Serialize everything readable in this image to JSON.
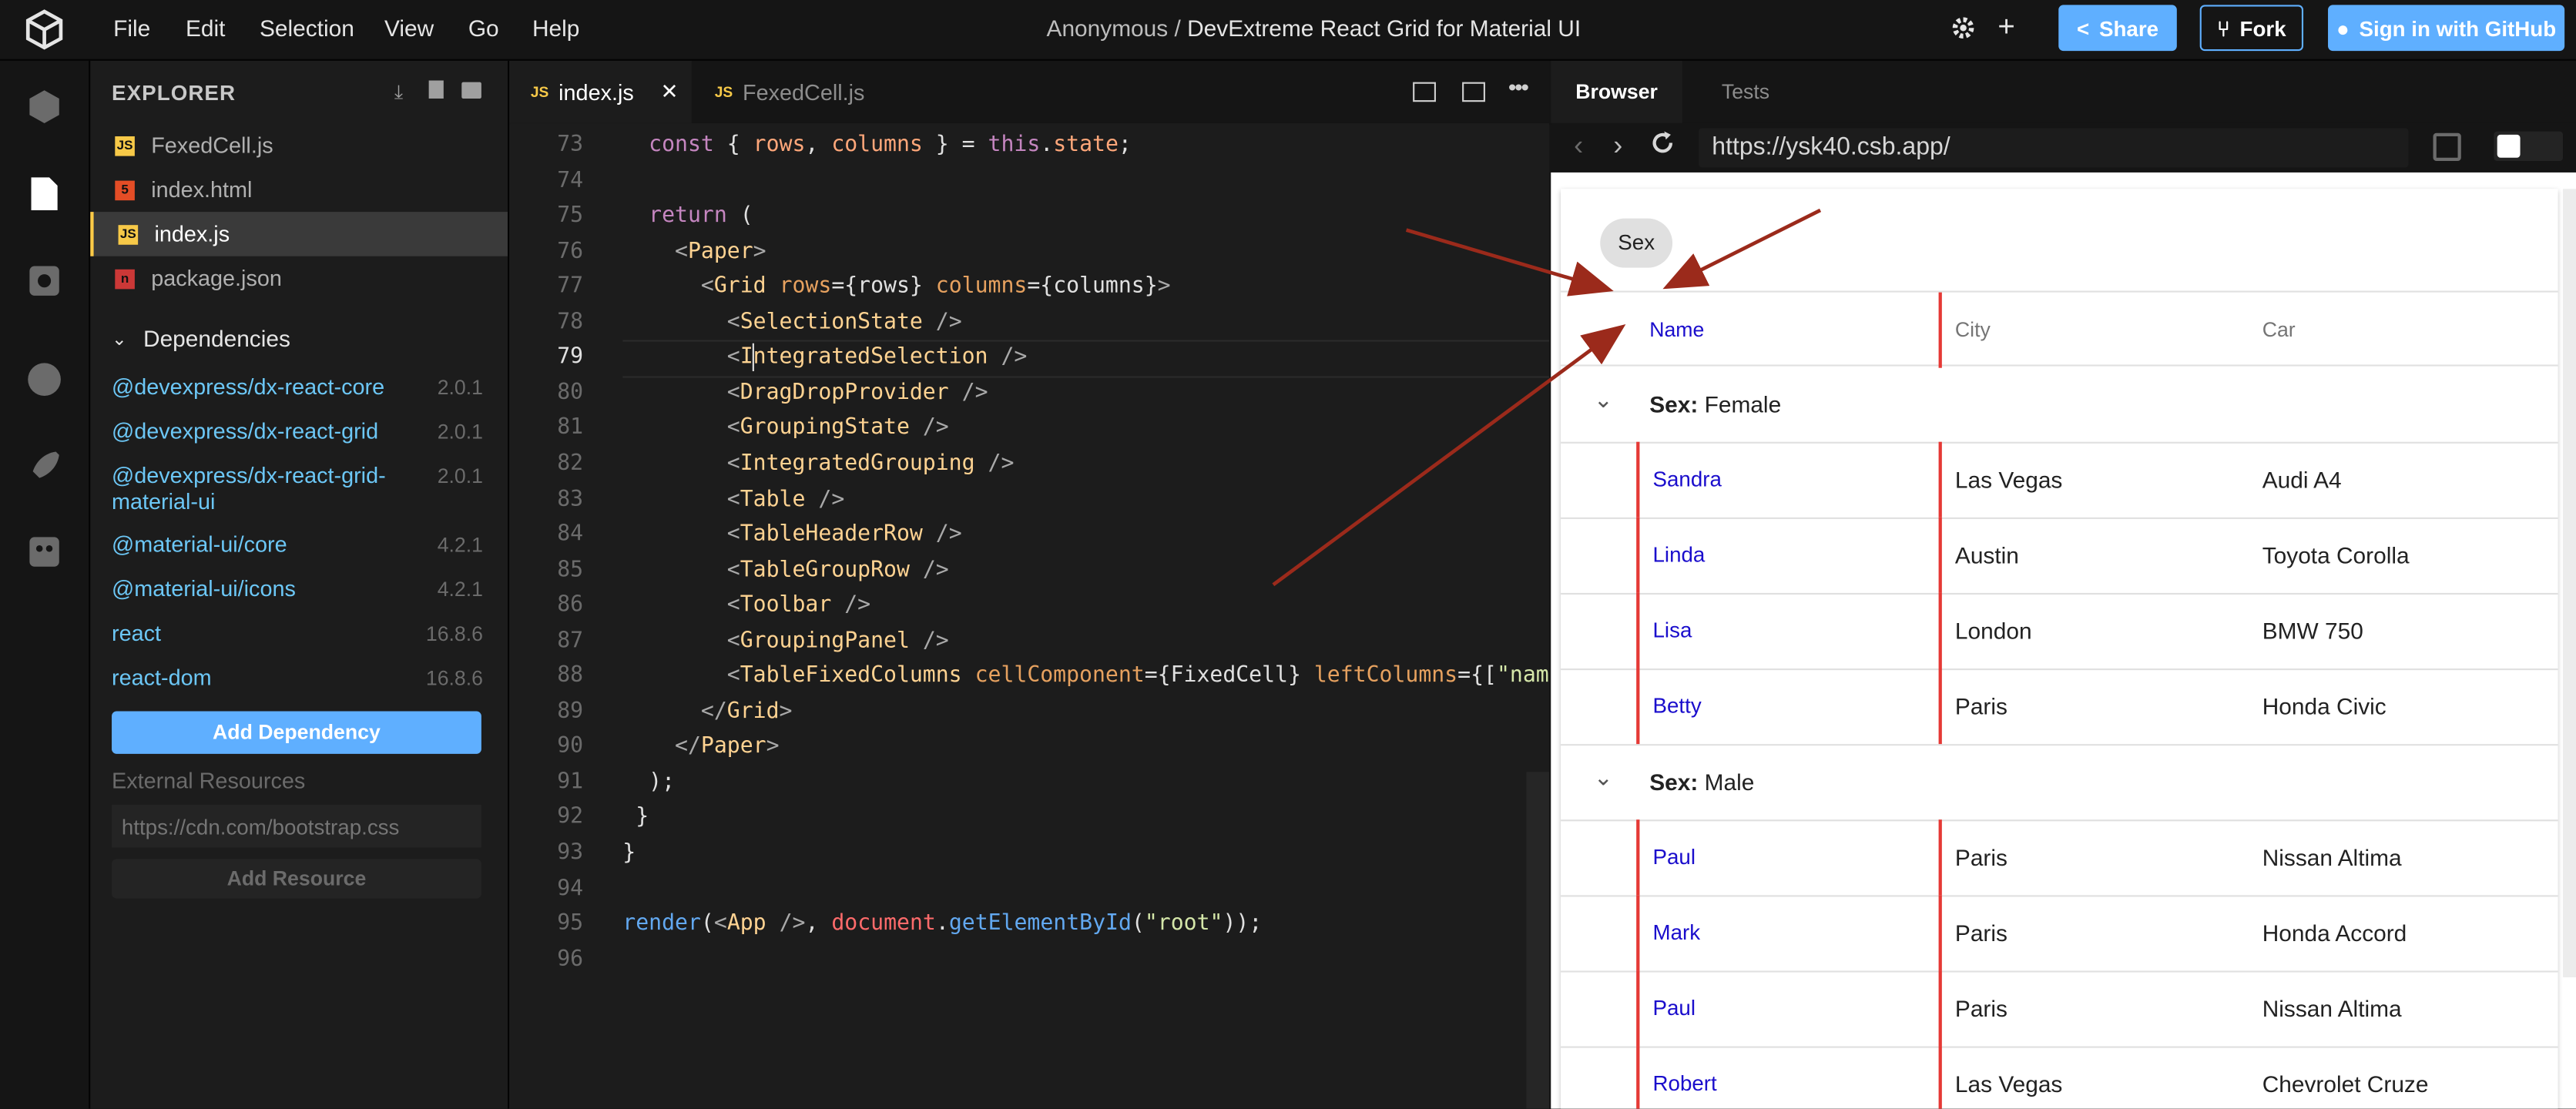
{
  "menu": [
    "File",
    "Edit",
    "Selection",
    "View",
    "Go",
    "Help"
  ],
  "title": {
    "owner": "Anonymous /",
    "project": "DevExtreme React Grid for Material UI"
  },
  "header_buttons": {
    "share": "Share",
    "fork": "Fork",
    "github": "Sign in with GitHub"
  },
  "sidebar": {
    "title": "EXPLORER",
    "files": [
      {
        "name": "FexedCell.js",
        "icon": "JS",
        "color": "#f7c948"
      },
      {
        "name": "index.html",
        "icon": "5",
        "color": "#e44d26"
      },
      {
        "name": "index.js",
        "icon": "JS",
        "color": "#f7c948"
      },
      {
        "name": "package.json",
        "icon": "n",
        "color": "#cb3837"
      }
    ],
    "dependencies_title": "Dependencies",
    "dependencies": [
      {
        "name": "@devexpress/dx-react-core",
        "version": "2.0.1"
      },
      {
        "name": "@devexpress/dx-react-grid",
        "version": "2.0.1"
      },
      {
        "name": "@devexpress/dx-react-grid-material-ui",
        "version": "2.0.1"
      },
      {
        "name": "@material-ui/core",
        "version": "4.2.1"
      },
      {
        "name": "@material-ui/icons",
        "version": "4.2.1"
      },
      {
        "name": "react",
        "version": "16.8.6"
      },
      {
        "name": "react-dom",
        "version": "16.8.6"
      }
    ],
    "add_dependency": "Add Dependency",
    "external_title": "External Resources",
    "external_placeholder": "https://cdn.com/bootstrap.css",
    "add_resource": "Add Resource"
  },
  "editor_tabs": [
    {
      "name": "index.js",
      "icon": "JS"
    },
    {
      "name": "FexedCell.js",
      "icon": "JS"
    }
  ],
  "browser": {
    "tabs": [
      "Browser",
      "Tests"
    ],
    "url": "https://ysk40.csb.app/"
  },
  "grid": {
    "group_chip": "Sex",
    "columns": [
      "Name",
      "City",
      "Car"
    ],
    "groups": [
      {
        "label": "Sex:",
        "value": "Female",
        "rows": [
          {
            "name": "Sandra",
            "city": "Las Vegas",
            "car": "Audi A4"
          },
          {
            "name": "Linda",
            "city": "Austin",
            "car": "Toyota Corolla"
          },
          {
            "name": "Lisa",
            "city": "London",
            "car": "BMW 750"
          },
          {
            "name": "Betty",
            "city": "Paris",
            "car": "Honda Civic"
          }
        ]
      },
      {
        "label": "Sex:",
        "value": "Male",
        "rows": [
          {
            "name": "Paul",
            "city": "Paris",
            "car": "Nissan Altima"
          },
          {
            "name": "Mark",
            "city": "Paris",
            "car": "Honda Accord"
          },
          {
            "name": "Paul",
            "city": "Paris",
            "car": "Nissan Altima"
          },
          {
            "name": "Robert",
            "city": "Las Vegas",
            "car": "Chevrolet Cruze"
          }
        ]
      }
    ]
  },
  "code_lines": [
    {
      "n": "73",
      "html": "  <span class='kw'>const</span> { <span class='vr'>rows</span>, <span class='vr'>columns</span> } = <span class='th'>this</span>.<span class='vr'>state</span>;"
    },
    {
      "n": "74",
      "html": ""
    },
    {
      "n": "75",
      "html": "  <span class='kw'>return</span> ("
    },
    {
      "n": "76",
      "html": "    <span class='pn'>&lt;</span><span class='tg'>Paper</span><span class='pn'>&gt;</span>"
    },
    {
      "n": "77",
      "html": "      <span class='pn'>&lt;</span><span class='tg'>Grid</span> <span class='at'>rows</span>={rows} <span class='at'>columns</span>={columns}<span class='pn'>&gt;</span>"
    },
    {
      "n": "78",
      "html": "        <span class='pn'>&lt;</span><span class='tg'>SelectionState</span> <span class='pn'>/&gt;</span>"
    },
    {
      "n": "79",
      "html": "        <span class='pn'>&lt;</span><span class='tg'>IntegratedSelection</span> <span class='pn'>/&gt;</span>"
    },
    {
      "n": "80",
      "html": "        <span class='pn'>&lt;</span><span class='tg'>DragDropProvider</span> <span class='pn'>/&gt;</span>"
    },
    {
      "n": "81",
      "html": "        <span class='pn'>&lt;</span><span class='tg'>GroupingState</span> <span class='pn'>/&gt;</span>"
    },
    {
      "n": "82",
      "html": "        <span class='pn'>&lt;</span><span class='tg'>IntegratedGrouping</span> <span class='pn'>/&gt;</span>"
    },
    {
      "n": "83",
      "html": "        <span class='pn'>&lt;</span><span class='tg'>Table</span> <span class='pn'>/&gt;</span>"
    },
    {
      "n": "84",
      "html": "        <span class='pn'>&lt;</span><span class='tg'>TableHeaderRow</span> <span class='pn'>/&gt;</span>"
    },
    {
      "n": "85",
      "html": "        <span class='pn'>&lt;</span><span class='tg'>TableGroupRow</span> <span class='pn'>/&gt;</span>"
    },
    {
      "n": "86",
      "html": "        <span class='pn'>&lt;</span><span class='tg'>Toolbar</span> <span class='pn'>/&gt;</span>"
    },
    {
      "n": "87",
      "html": "        <span class='pn'>&lt;</span><span class='tg'>GroupingPanel</span> <span class='pn'>/&gt;</span>"
    },
    {
      "n": "88",
      "html": "        <span class='pn'>&lt;</span><span class='tg'>TableFixedColumns</span> <span class='at'>cellComponent</span>={FixedCell} <span class='at'>leftColumns</span>={[<span class='st'>\"nam</span>"
    },
    {
      "n": "89",
      "html": "      <span class='pn'>&lt;/</span><span class='tg'>Grid</span><span class='pn'>&gt;</span>"
    },
    {
      "n": "90",
      "html": "    <span class='pn'>&lt;/</span><span class='tg'>Paper</span><span class='pn'>&gt;</span>"
    },
    {
      "n": "91",
      "html": "  );"
    },
    {
      "n": "92",
      "html": " }"
    },
    {
      "n": "93",
      "html": "}"
    },
    {
      "n": "94",
      "html": ""
    },
    {
      "n": "95",
      "html": "<span class='fn'>render</span>(<span class='pn'>&lt;</span><span class='tg'>App</span> <span class='pn'>/&gt;</span>, <span class='dc'>document</span>.<span class='fn'>getElementById</span>(<span class='st'>\"root\"</span>));"
    },
    {
      "n": "96",
      "html": ""
    }
  ],
  "colors": {
    "accent": "#5fafff",
    "annotation_arrow": "#9b2a1b",
    "fixed_column_border": "#e53935",
    "link_blue": "#1a0dcc"
  }
}
